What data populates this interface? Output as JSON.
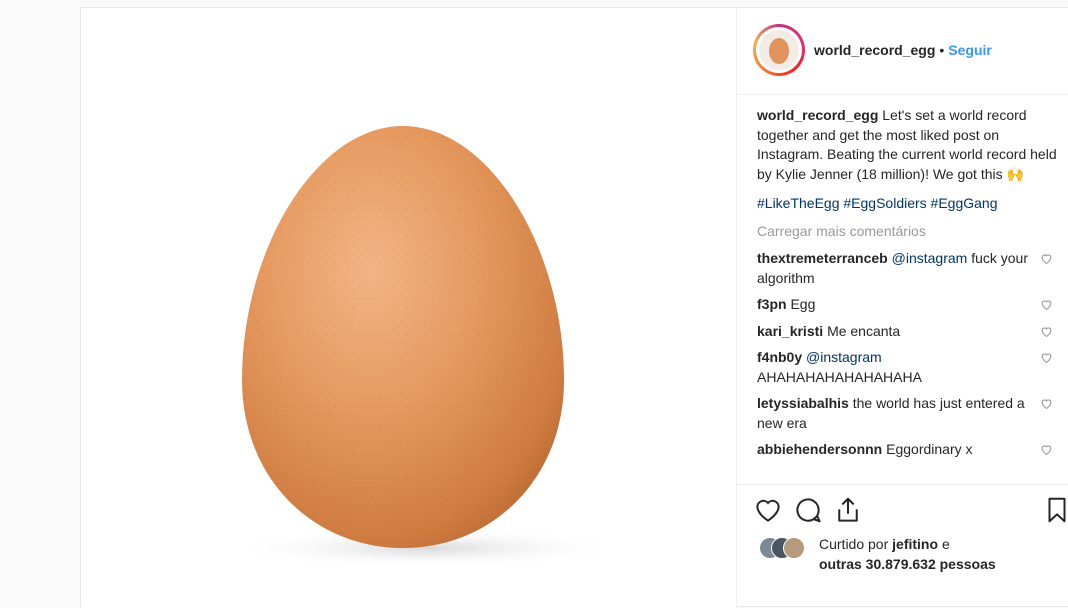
{
  "colors": {
    "link_blue": "#3897f0",
    "hashtag_blue": "#003569",
    "muted_gray": "#999999",
    "egg_orange": "#e0935a"
  },
  "header": {
    "username": "world_record_egg",
    "dot": "•",
    "follow_label": "Seguir"
  },
  "caption": {
    "username": "world_record_egg",
    "text": "Let's set a world record together and get the most liked post on Instagram. Beating the current world record held by Kylie Jenner (18 million)! We got this",
    "emoji": "🙌",
    "hashtags": "#LikeTheEgg #EggSoldiers #EggGang"
  },
  "load_more_label": "Carregar mais comentários",
  "comments": [
    {
      "user": "thextremeterranceb",
      "mention": "@instagram",
      "text": "fuck your algorithm"
    },
    {
      "user": "f3pn",
      "mention": "",
      "text": "Egg"
    },
    {
      "user": "kari_kristi",
      "mention": "",
      "text": "Me encanta"
    },
    {
      "user": "f4nb0y",
      "mention": "@instagram",
      "text": "AHAHAHAHAHAHAHAHA"
    },
    {
      "user": "letyssiabalhis",
      "mention": "",
      "text": "the world has just entered a new era"
    },
    {
      "user": "abbiehendersonnn",
      "mention": "",
      "text": "Eggordinary x"
    }
  ],
  "icons": {
    "like": "heart-icon",
    "comment": "comment-icon",
    "share": "share-icon",
    "save": "bookmark-icon",
    "comment_like": "heart-icon"
  },
  "likes": {
    "prefix": "Curtido por",
    "user": "jefitino",
    "conjunction": "e",
    "others": "outras 30.879.632 pessoas"
  }
}
